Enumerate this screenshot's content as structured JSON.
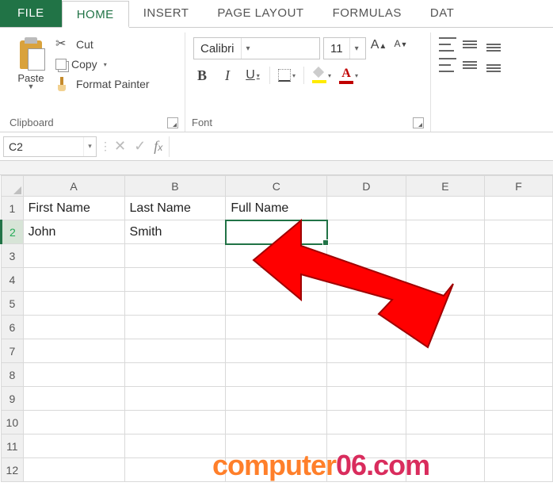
{
  "tabs": {
    "file": "FILE",
    "home": "HOME",
    "insert": "INSERT",
    "pageLayout": "PAGE LAYOUT",
    "formulas": "FORMULAS",
    "data": "DAT"
  },
  "clipboard": {
    "paste": "Paste",
    "cut": "Cut",
    "copy": "Copy",
    "formatPainter": "Format Painter",
    "groupLabel": "Clipboard"
  },
  "font": {
    "name": "Calibri",
    "size": "11",
    "bold": "B",
    "italic": "I",
    "underline": "U",
    "aBig": "A",
    "aSmall": "A",
    "colorA": "A",
    "groupLabel": "Font"
  },
  "namebox": "C2",
  "formula": "",
  "columns": [
    "A",
    "B",
    "C",
    "D",
    "E",
    "F"
  ],
  "rows": [
    "1",
    "2",
    "3",
    "4",
    "5",
    "6",
    "7",
    "8",
    "9",
    "10",
    "11",
    "12"
  ],
  "cells": {
    "A1": "First Name",
    "B1": "Last Name",
    "C1": "Full Name",
    "A2": "John",
    "B2": "Smith"
  },
  "selectedCell": "C2",
  "watermark": {
    "part1": "computer",
    "part2": "06.com"
  }
}
